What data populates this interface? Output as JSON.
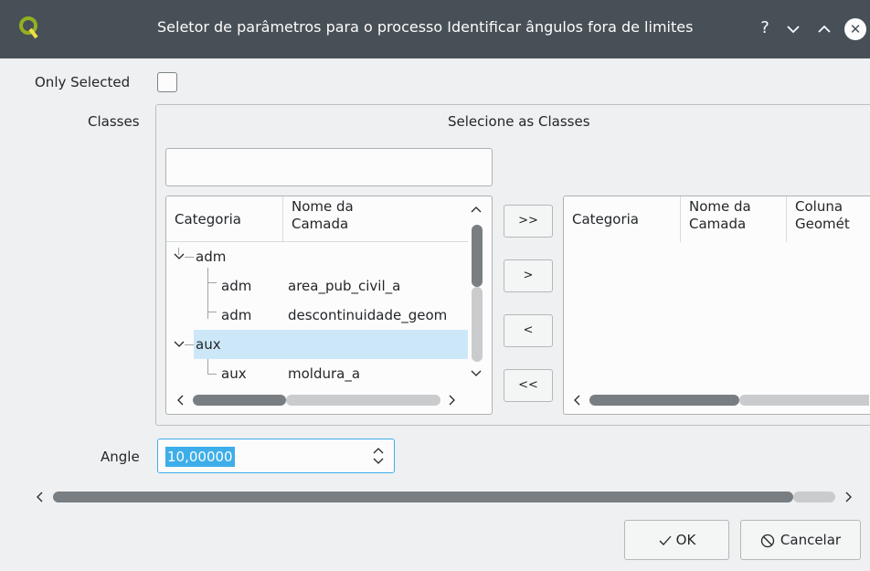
{
  "titlebar": {
    "title": "Seletor de parâmetros para o processo Identificar ângulos fora de limites",
    "help": "?",
    "minimize": "⌄",
    "maximize": "⌃",
    "close": "✕"
  },
  "only_selected": {
    "label": "Only Selected",
    "checked": false
  },
  "classes": {
    "label": "Classes",
    "group_title": "Selecione as Classes",
    "filter_value": "",
    "left_table": {
      "headers": [
        "Categoria",
        "Nome da Camada"
      ],
      "rows": [
        {
          "category": "adm",
          "layer": "",
          "level": 0,
          "expanded": true
        },
        {
          "category": "adm",
          "layer": "area_pub_civil_a",
          "level": 1
        },
        {
          "category": "adm",
          "layer": "descontinuidade_geom",
          "level": 1
        },
        {
          "category": "aux",
          "layer": "",
          "level": 0,
          "expanded": true,
          "selected": true
        },
        {
          "category": "aux",
          "layer": "moldura_a",
          "level": 1
        }
      ]
    },
    "move_buttons": {
      "add_all": ">>",
      "add": ">",
      "remove": "<",
      "remove_all": "<<"
    },
    "right_table": {
      "headers": [
        "Categoria",
        "Nome da Camada",
        "Coluna Geomét"
      ]
    }
  },
  "angle": {
    "label": "Angle",
    "value": "10,00000"
  },
  "buttons": {
    "ok": "OK",
    "cancel": "Cancelar"
  },
  "colors": {
    "titlebar": "#475057",
    "highlight": "#3daee9",
    "selection": "#cce8f8"
  }
}
